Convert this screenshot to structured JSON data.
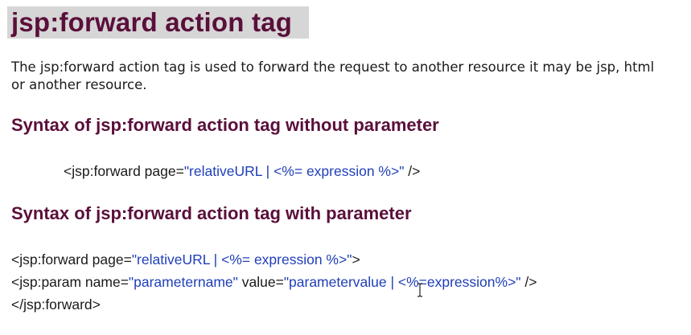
{
  "title": "jsp:forward action tag",
  "intro": "The jsp:forward action tag is used to forward the request to another resource it may be jsp, html or another resource.",
  "section_without": {
    "heading": "Syntax of jsp:forward action tag without parameter",
    "code": {
      "pre": "<jsp:forward page=",
      "value": "\"relativeURL | <%= expression %>\"",
      "post": " />"
    }
  },
  "section_with": {
    "heading": "Syntax of jsp:forward action tag with parameter",
    "line1": {
      "pre": "<jsp:forward page=",
      "value": "\"relativeURL | <%= expression %>\"",
      "post": ">"
    },
    "line2": {
      "pre": "<jsp:param name=",
      "value1": "\"parametername\"",
      "mid": " value=",
      "value2": "\"parametervalue | <%=expression%>\"",
      "post": " />"
    },
    "line3": "</jsp:forward>"
  },
  "colors": {
    "heading": "#5a0f3a",
    "code_value": "#1f3fb8",
    "title_band": "#d6d6d6"
  },
  "icons": {
    "cursor": "text-cursor-icon"
  }
}
